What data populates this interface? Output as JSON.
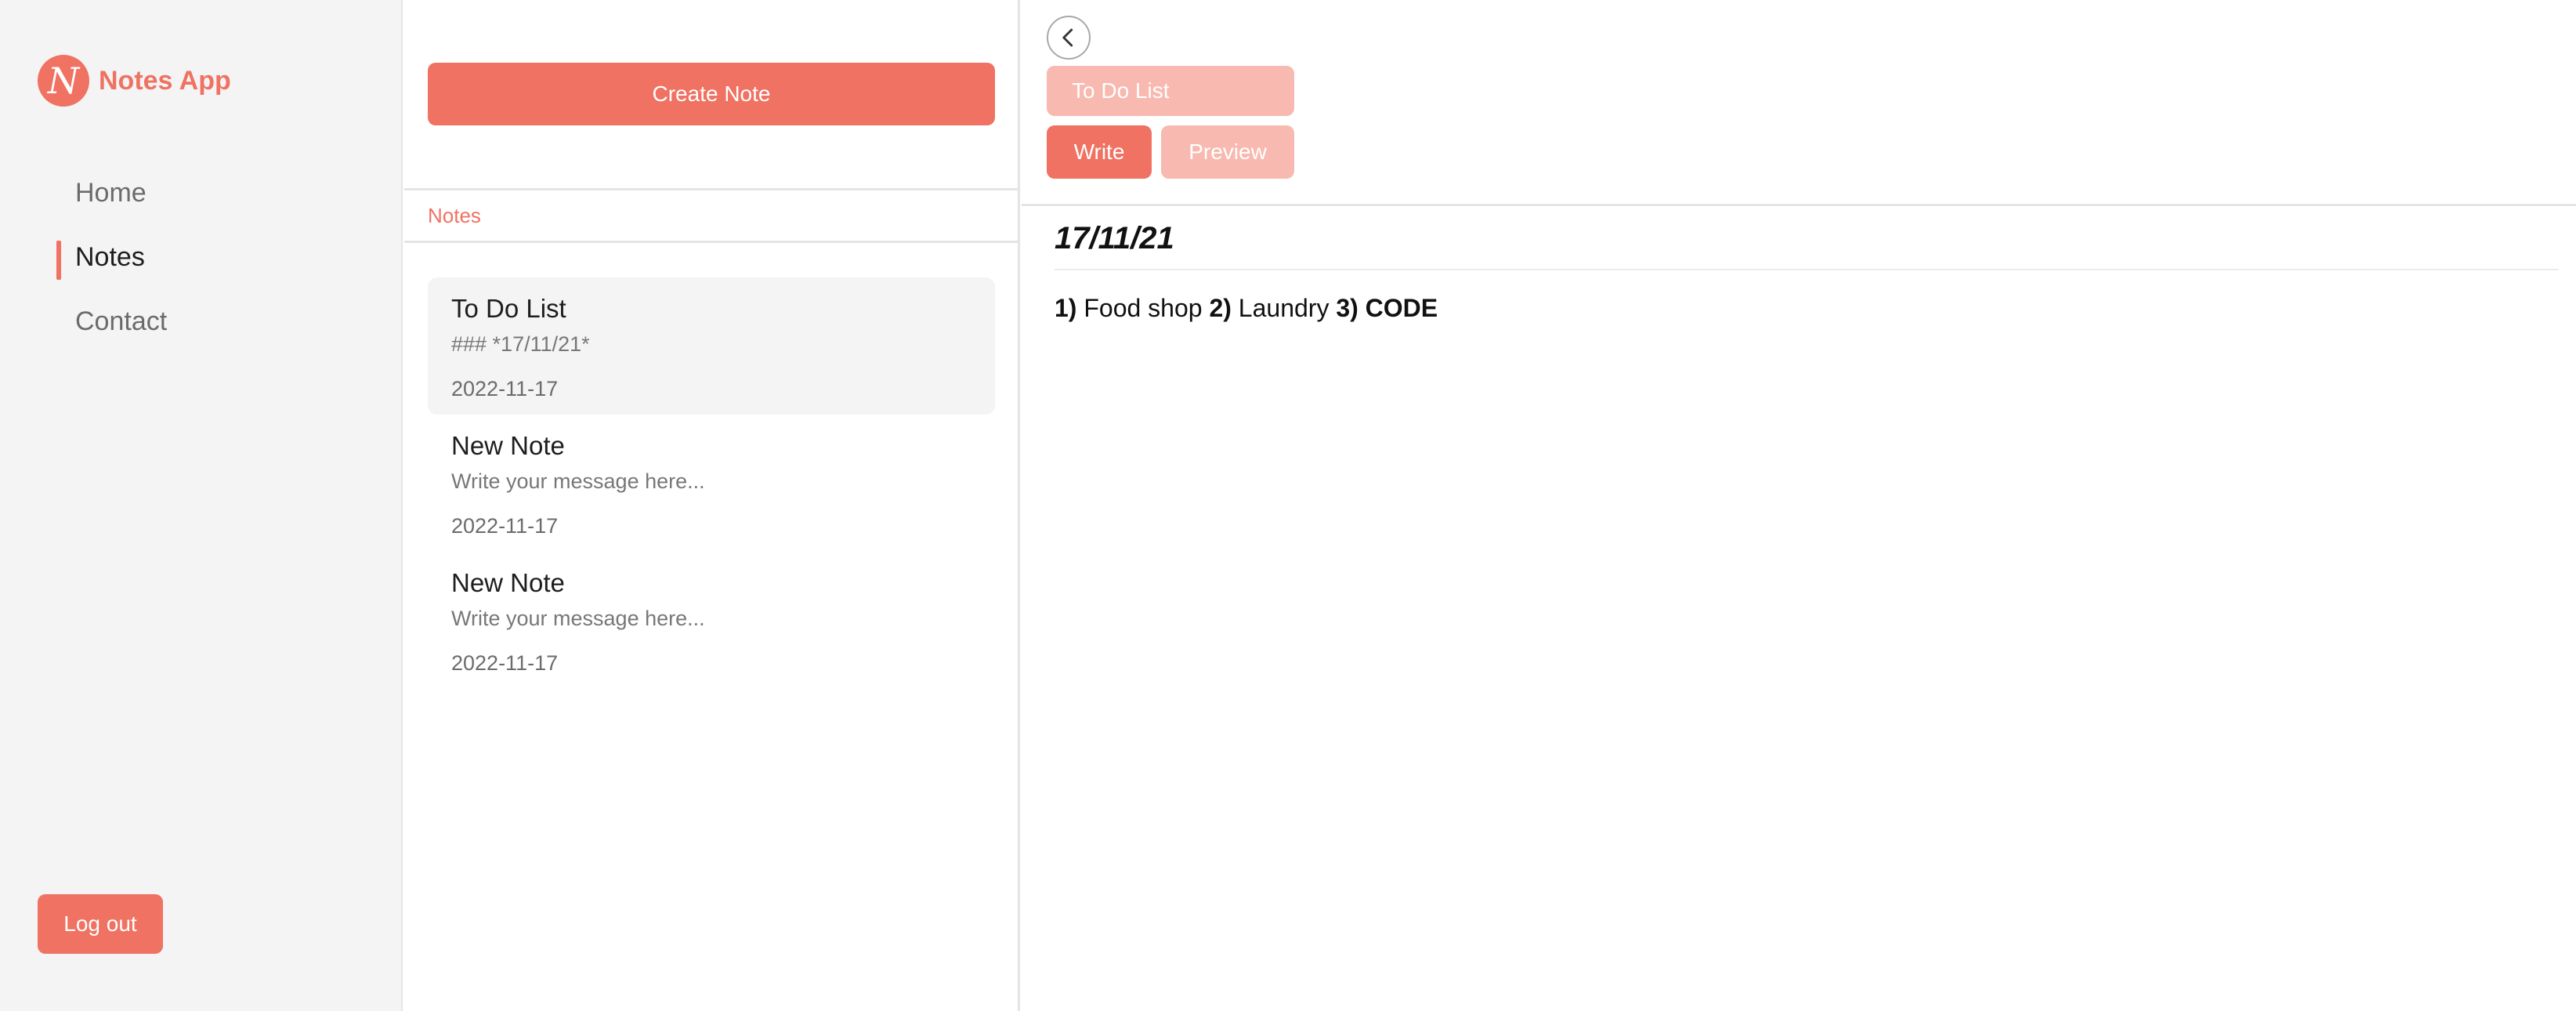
{
  "sidebar": {
    "brand": {
      "logo_letter": "N",
      "name": "Notes App"
    },
    "nav": [
      {
        "label": "Home",
        "active": false
      },
      {
        "label": "Notes",
        "active": true
      },
      {
        "label": "Contact",
        "active": false
      }
    ],
    "logout_label": "Log out"
  },
  "list": {
    "create_label": "Create Note",
    "header": "Notes",
    "notes": [
      {
        "title": "To Do List",
        "preview": "### *17/11/21*",
        "date": "2022-11-17",
        "selected": true
      },
      {
        "title": "New Note",
        "preview": "Write your message here...",
        "date": "2022-11-17",
        "selected": false
      },
      {
        "title": "New Note",
        "preview": "Write your message here...",
        "date": "2022-11-17",
        "selected": false
      }
    ]
  },
  "editor": {
    "back_icon": "chevron-left-icon",
    "title_value": "To Do List",
    "tabs": {
      "write": "Write",
      "preview": "Preview",
      "active": "write"
    },
    "content": {
      "heading": "17/11/21",
      "items": [
        {
          "num": "1)",
          "text": "Food shop"
        },
        {
          "num": "2)",
          "text": "Laundry"
        },
        {
          "num": "3)",
          "text": "CODE",
          "bold": true
        }
      ]
    }
  },
  "colors": {
    "accent": "#ef7262",
    "accent_light": "#f8b9b0",
    "sidebar_bg": "#f4f4f4",
    "selected_card_bg": "#f4f4f4"
  }
}
